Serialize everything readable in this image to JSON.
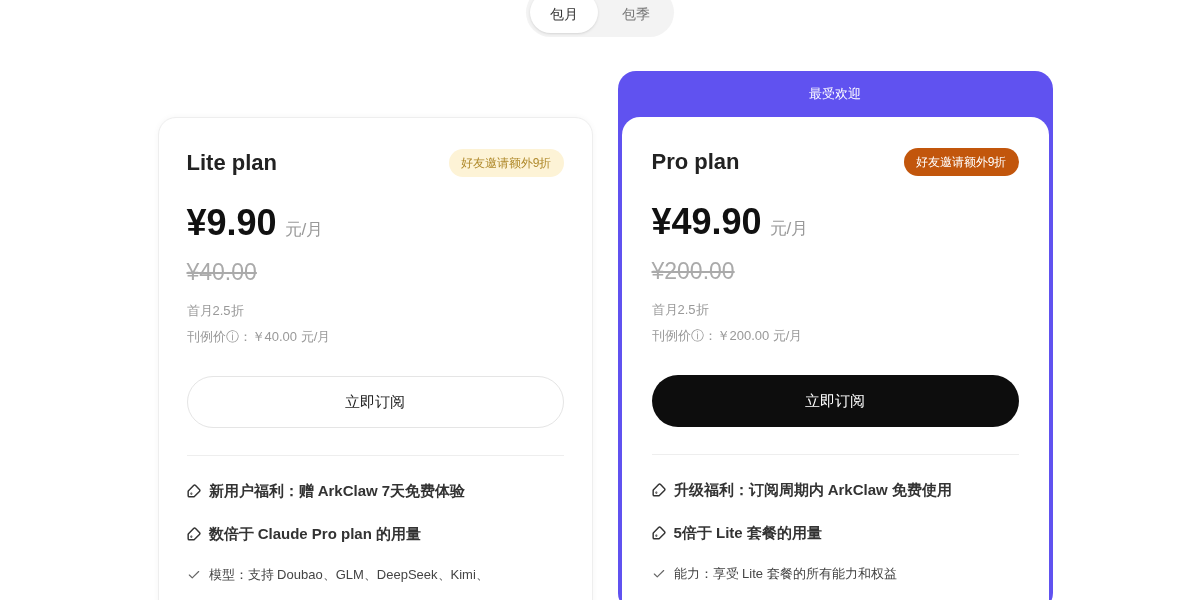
{
  "billing_tabs": [
    {
      "label": "包月",
      "selected": true
    },
    {
      "label": "包季",
      "selected": false
    }
  ],
  "plans": [
    {
      "name": "Lite plan",
      "featured": false,
      "badge": "好友邀请额外9折",
      "price": "¥9.90",
      "unit": "元/月",
      "original_price": "¥40.00",
      "first_month": "首月2.5折",
      "list_price_label": "刊例价ⓘ：",
      "list_price": "￥40.00 元/月",
      "button": "立即订阅",
      "features": [
        {
          "kind": "highlight",
          "text": "新用户福利：赠 ArkClaw 7天免费体验"
        },
        {
          "kind": "highlight",
          "text": "数倍于 Claude Pro plan 的用量"
        },
        {
          "kind": "check",
          "text": "模型：支持 Doubao、GLM、DeepSeek、Kimi、"
        }
      ]
    },
    {
      "name": "Pro plan",
      "featured": true,
      "banner": "最受欢迎",
      "badge": "好友邀请额外9折",
      "price": "¥49.90",
      "unit": "元/月",
      "original_price": "¥200.00",
      "first_month": "首月2.5折",
      "list_price_label": "刊例价ⓘ：",
      "list_price": "￥200.00 元/月",
      "button": "立即订阅",
      "features": [
        {
          "kind": "highlight",
          "text": "升级福利：订阅周期内 ArkClaw 免费使用"
        },
        {
          "kind": "highlight",
          "text": "5倍于 Lite 套餐的用量"
        },
        {
          "kind": "check",
          "text": "能力：享受 Lite 套餐的所有能力和权益"
        }
      ]
    }
  ]
}
